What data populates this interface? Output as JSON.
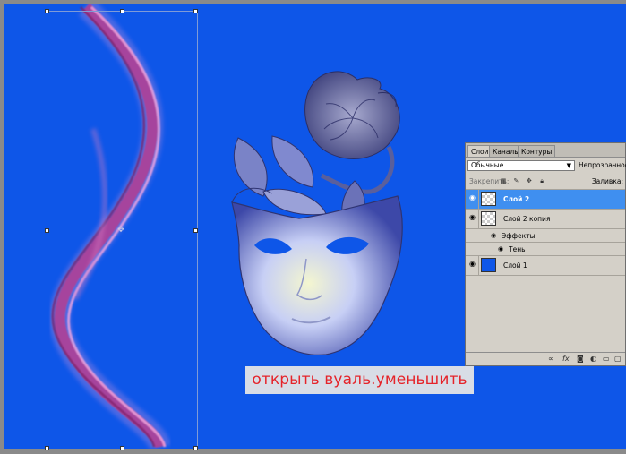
{
  "canvas": {
    "background": "#0e56e8",
    "caption": "открыть вуаль.уменьшить"
  },
  "layers_panel": {
    "tabs": [
      {
        "label": "Слои",
        "active": true
      },
      {
        "label": "Каналы",
        "active": false
      },
      {
        "label": "Контуры",
        "active": false
      }
    ],
    "blend_mode": "Обычные",
    "opacity_label": "Непрозрачность:",
    "lock_label": "Закрепить:",
    "fill_label": "Заливка:",
    "layers": [
      {
        "name": "Слой 2",
        "selected": true,
        "thumb": "transparent",
        "visible": true
      },
      {
        "name": "Слой 2 копия",
        "selected": false,
        "thumb": "transparent-mask",
        "visible": true,
        "fx": "fx"
      },
      {
        "name": "Слой 1",
        "selected": false,
        "thumb": "blue-fill",
        "visible": true
      }
    ],
    "effects_label": "Эффекты",
    "shadow_label": "Тень",
    "bottom_icons": [
      "link-icon",
      "fx-icon",
      "mask-icon",
      "adjustment-icon",
      "folder-icon",
      "new-layer-icon",
      "trash-icon"
    ]
  }
}
